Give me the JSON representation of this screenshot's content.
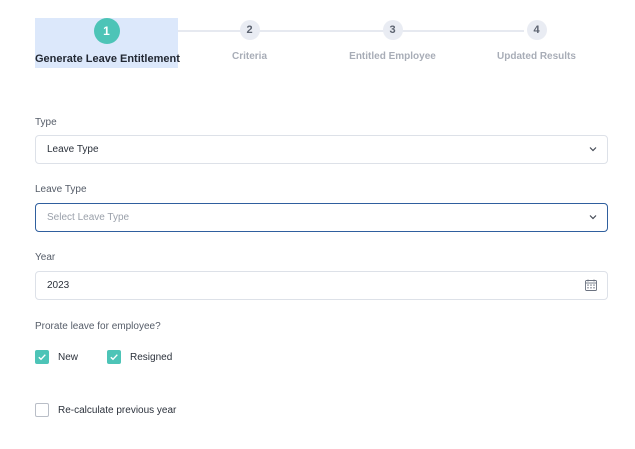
{
  "stepper": {
    "steps": [
      {
        "number": "1",
        "label": "Generate Leave Entitlement",
        "active": true
      },
      {
        "number": "2",
        "label": "Criteria",
        "active": false
      },
      {
        "number": "3",
        "label": "Entitled Employee",
        "active": false
      },
      {
        "number": "4",
        "label": "Updated Results",
        "active": false
      }
    ]
  },
  "form": {
    "type": {
      "label": "Type",
      "value": "Leave Type"
    },
    "leave_type": {
      "label": "Leave Type",
      "placeholder": "Select Leave Type"
    },
    "year": {
      "label": "Year",
      "value": "2023"
    },
    "prorate": {
      "label": "Prorate leave for employee?",
      "new": {
        "label": "New",
        "checked": true
      },
      "resigned": {
        "label": "Resigned",
        "checked": true
      }
    },
    "recalculate": {
      "label": "Re-calculate previous year",
      "checked": false
    }
  },
  "colors": {
    "accent": "#4dc4b7",
    "active_step_bg": "#dce8fb",
    "focus_border": "#2f5f9e"
  },
  "icons": {
    "dropdown": "chevron-down-icon",
    "calendar": "calendar-icon",
    "check": "check-icon"
  }
}
